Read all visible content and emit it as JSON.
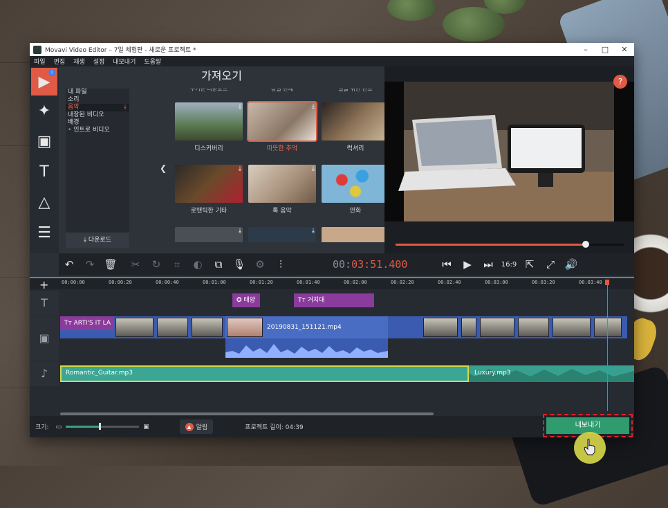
{
  "window": {
    "title": "Movavi Video Editor – 7일 체험판 - 새로운 프로젝트 *"
  },
  "menu": [
    "파일",
    "편집",
    "재생",
    "설정",
    "내보내기",
    "도움말"
  ],
  "left_tools": [
    "import-icon",
    "magic-wand-icon",
    "film-icon",
    "text-icon",
    "shapes-icon",
    "list-icon"
  ],
  "import": {
    "title": "가져오기",
    "categories": [
      "내 파일",
      "소리",
      "음악",
      "내장된 비디오",
      "배경",
      "인트로 비디오"
    ],
    "download_label": "다운로드",
    "partial_labels": [
      "무거운 다운로드",
      "강렬 판제",
      "귤을 위한 관조"
    ],
    "tiles": [
      "디스커버리",
      "따뜻한 추억",
      "럭셔리",
      "로맨틱한 기타",
      "록 음악",
      "만화"
    ]
  },
  "preview": {
    "help": "?",
    "timecode_prefix": "00:",
    "timecode_main": "03:51.400",
    "ratio": "16:9",
    "progress": 0.83
  },
  "timeline": {
    "ticks": [
      "00:00:00",
      "00:00:20",
      "00:00:40",
      "00:01:00",
      "00:01:20",
      "00:01:40",
      "00:02:00",
      "00:02:20",
      "00:02:40",
      "00:03:00",
      "00:03:20",
      "00:03:40"
    ],
    "text_clips": [
      "태양",
      "거치대"
    ],
    "title_clip": "ARTI'S IT LA",
    "video_clip": "20190831_151121.mp4",
    "audio_clip1": "Romantic_Guitar.mp3",
    "audio_clip2": "Luxury.mp3"
  },
  "bottom": {
    "size_label": "크기:",
    "notif": "알림",
    "project_length": "프로젝트 길이:  04:39",
    "export": "내보내기"
  }
}
